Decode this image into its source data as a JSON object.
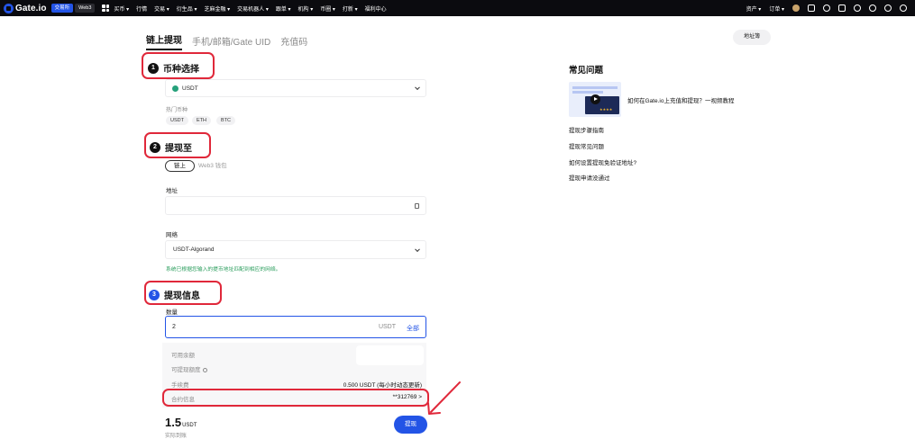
{
  "topbar": {
    "brand": "Gate.io",
    "pill_exchange": "交易所",
    "pill_web3": "Web3",
    "nav": [
      "买币 ▾",
      "行情",
      "交易 ▾",
      "衍生品 ▾",
      "芝麻金融 ▾",
      "交易机器人 ▾",
      "跟单 ▾",
      "机构 ▾",
      "币圈 ▾",
      "打新 ▾",
      "福利中心"
    ],
    "right": [
      "资产 ▾",
      "订单 ▾"
    ]
  },
  "tabs": [
    "链上提现",
    "手机/邮箱/Gate UID",
    "充值码"
  ],
  "address_book": "地址簿",
  "step1": {
    "num": "1",
    "title": "币种选择"
  },
  "coin_select": {
    "value": "USDT"
  },
  "hot_label": "热门币种",
  "hot_coins": [
    "USDT",
    "ETH",
    "BTC"
  ],
  "step2": {
    "num": "2",
    "title": "提现至"
  },
  "dest_tabs": {
    "on": "链上",
    "off": "Web3 钱包"
  },
  "address_label": "地址",
  "network_label": "网络",
  "network_value": "USDT-Algorand",
  "network_hint": "系统已根据您输入的提币地址匹配到相应的网络。",
  "step3": {
    "num": "3",
    "title": "提现信息"
  },
  "qty_label": "数量",
  "qty_value": "2",
  "qty_unit": "USDT",
  "qty_all": "全部",
  "rows": {
    "available": "可用余额",
    "withdrawable": "可提现额度",
    "fee_label": "手续费",
    "fee_value": "0.500 USDT (每小时动态更新)",
    "contract_label": "合约信息",
    "contract_value": "**312769 >"
  },
  "receive_amount": "1.5",
  "receive_unit": "USDT",
  "receive_label": "实际到账",
  "submit": "提现",
  "faq": {
    "title": "常见问题",
    "video_title": "如何在Gate.io上充值和提现？一视频教程",
    "links": [
      "提现步骤指南",
      "提现常见问题",
      "如何设置提现免验证地址?",
      "提现申请没通过"
    ]
  },
  "colors": {
    "accent": "#2354e6",
    "highlight": "#e0283a",
    "hint": "#2a9d5c"
  }
}
